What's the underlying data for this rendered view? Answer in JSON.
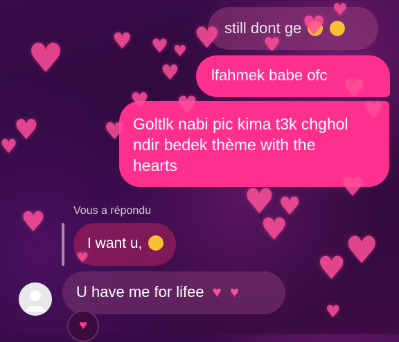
{
  "messages": {
    "sent_gray": "still dont ge",
    "sent_pink_1": "lfahmek babe ofc",
    "sent_pink_2_line1": "Goltlk nabi pic kima t3k chghol",
    "sent_pink_2_line2": "ndir bedek thème with the",
    "sent_pink_2_line3": "hearts",
    "reply_label": "Vous a répondu",
    "reply_text": "I want u,",
    "received_text": "U have me for lifee"
  },
  "icons": {
    "sent_gray_emojis": [
      "crying-face",
      "crying-face"
    ],
    "reply_emoji": "pensive-face",
    "received_emojis": [
      "heart",
      "heart"
    ],
    "reaction": "heart",
    "avatar": "default-user-avatar",
    "background_decoration": "floating-hearts"
  },
  "colors": {
    "accent_pink": "#ff2f8e",
    "heart": "#ff4f9a",
    "emoji_yellow": "#f6c233"
  }
}
